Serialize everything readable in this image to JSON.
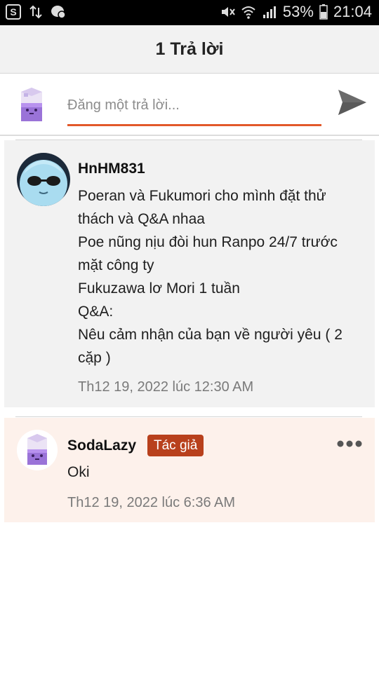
{
  "status_bar": {
    "battery_percent": "53%",
    "time": "21:04",
    "icons": [
      "skype-icon",
      "data-transfer-icon",
      "messenger-icon",
      "mute-icon",
      "wifi-icon",
      "signal-icon",
      "battery-icon"
    ]
  },
  "header": {
    "title": "1 Trả lời"
  },
  "composer": {
    "placeholder": "Đăng một trả lời...",
    "value": "",
    "accent_color": "#e2592a"
  },
  "comments": [
    {
      "username": "HnHM831",
      "lines": [
        "Poeran và Fukumori cho mình đặt thử thách và Q&A nhaa",
        "Poe nũng nịu đòi hun Ranpo 24/7 trước mặt công ty",
        "Fukuzawa lơ Mori 1 tuần",
        "Q&A:",
        "Nêu cảm nhận của bạn về người yêu ( 2 cặp )"
      ],
      "timestamp": "Th12 19, 2022 lúc 12:30 AM"
    },
    {
      "username": "SodaLazy",
      "badge": "Tác giả",
      "badge_color": "#b8401c",
      "text": "Oki",
      "timestamp": "Th12 19, 2022 lúc 6:36 AM"
    }
  ]
}
